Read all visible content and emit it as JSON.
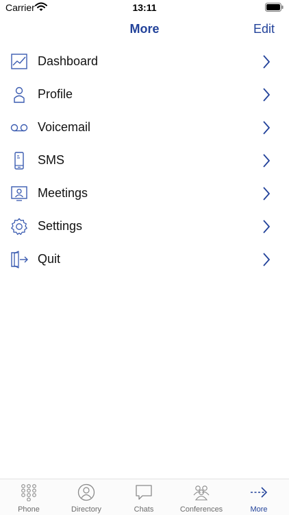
{
  "status_bar": {
    "carrier": "Carrier",
    "time": "13:11"
  },
  "nav": {
    "title": "More",
    "edit_label": "Edit"
  },
  "menu": {
    "items": [
      {
        "label": "Dashboard",
        "icon": "dashboard-chart-icon"
      },
      {
        "label": "Profile",
        "icon": "person-icon"
      },
      {
        "label": "Voicemail",
        "icon": "voicemail-icon"
      },
      {
        "label": "SMS",
        "icon": "phone-sms-icon"
      },
      {
        "label": "Meetings",
        "icon": "meeting-monitor-icon"
      },
      {
        "label": "Settings",
        "icon": "gear-icon"
      },
      {
        "label": "Quit",
        "icon": "exit-door-icon"
      }
    ]
  },
  "tab_bar": {
    "tabs": [
      {
        "label": "Phone",
        "icon": "keypad-icon",
        "active": false
      },
      {
        "label": "Directory",
        "icon": "contact-icon",
        "active": false
      },
      {
        "label": "Chats",
        "icon": "chat-bubble-icon",
        "active": false
      },
      {
        "label": "Conferences",
        "icon": "group-icon",
        "active": false
      },
      {
        "label": "More",
        "icon": "more-arrow-icon",
        "active": true
      }
    ]
  },
  "colors": {
    "accent": "#22429a",
    "tab_inactive": "#6b6b6b",
    "icon_stroke": "#3a5bb0"
  }
}
